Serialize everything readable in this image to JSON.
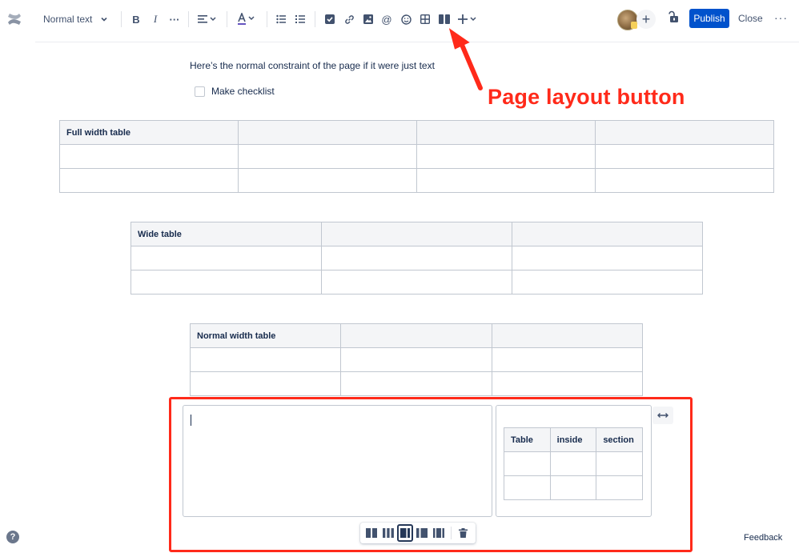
{
  "toolbar": {
    "text_style": "Normal text",
    "publish_label": "Publish",
    "close_label": "Close",
    "more_icon": "ellipsis-icon"
  },
  "annotation": {
    "label": "Page layout button",
    "color": "#ff2a1a"
  },
  "editor": {
    "intro_text": "Here’s the normal constraint of the page if it were just text",
    "checklist_label": "Make checklist",
    "tables": [
      {
        "header": [
          "Full width table",
          "",
          "",
          ""
        ],
        "rows": [
          [
            "",
            "",
            "",
            ""
          ],
          [
            "",
            "",
            "",
            ""
          ]
        ]
      },
      {
        "header": [
          "Wide table",
          "",
          ""
        ],
        "rows": [
          [
            "",
            "",
            ""
          ],
          [
            "",
            "",
            ""
          ]
        ]
      },
      {
        "header": [
          "Normal width table",
          "",
          ""
        ],
        "rows": [
          [
            "",
            "",
            ""
          ],
          [
            "",
            "",
            ""
          ]
        ]
      }
    ],
    "section_table": {
      "header": [
        "Table",
        "inside",
        "section"
      ],
      "rows": [
        [
          "",
          "",
          ""
        ],
        [
          "",
          "",
          ""
        ]
      ]
    }
  },
  "footer": {
    "help_label": "?",
    "feedback_label": "Feedback"
  },
  "colors": {
    "primary": "#0052cc",
    "border": "#c1c7d0",
    "header_bg": "#f4f5f7",
    "annotation": "#ff2a1a"
  }
}
